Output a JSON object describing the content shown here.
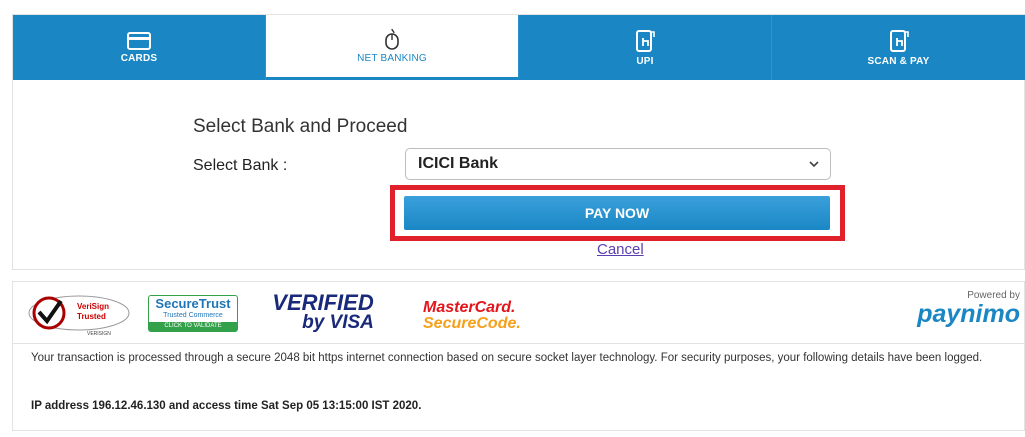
{
  "tabs": [
    {
      "label": "CARDS",
      "icon": "card-icon",
      "active": false
    },
    {
      "label": "NET BANKING",
      "icon": "mouse-icon",
      "active": true
    },
    {
      "label": "UPI",
      "icon": "phone-tap-icon",
      "active": false
    },
    {
      "label": "SCAN & PAY",
      "icon": "phone-tap-icon",
      "active": false
    }
  ],
  "panel": {
    "title": "Select Bank and Proceed",
    "bank_label": "Select Bank :",
    "bank_selected": "ICICI Bank",
    "pay_button": "PAY NOW",
    "cancel_link": "Cancel"
  },
  "badges": {
    "verisign_line1": "VeriSign",
    "verisign_line2": "Trusted",
    "verisign_line3": "VERISIGN",
    "securetrust_line1": "SecureTrust",
    "securetrust_line2": "Trusted Commerce",
    "securetrust_line3": "CLICK TO VALIDATE",
    "visa_line1": "VERIFIED",
    "visa_line2": "by VISA",
    "mastercard_line1": "MasterCard.",
    "mastercard_line2": "SecureCode.",
    "powered_by": "Powered by",
    "paynimo": "paynimo"
  },
  "footer": {
    "notice": "Your transaction is processed through a secure 2048 bit https internet connection based on secure socket layer technology. For security purposes, your following details have been logged.",
    "ip_line": "IP address 196.12.46.130 and access time Sat Sep 05 13:15:00 IST 2020."
  },
  "colors": {
    "tab_blue": "#1a87c4",
    "highlight_red": "#e0202a",
    "link_purple": "#5b3fb0"
  }
}
